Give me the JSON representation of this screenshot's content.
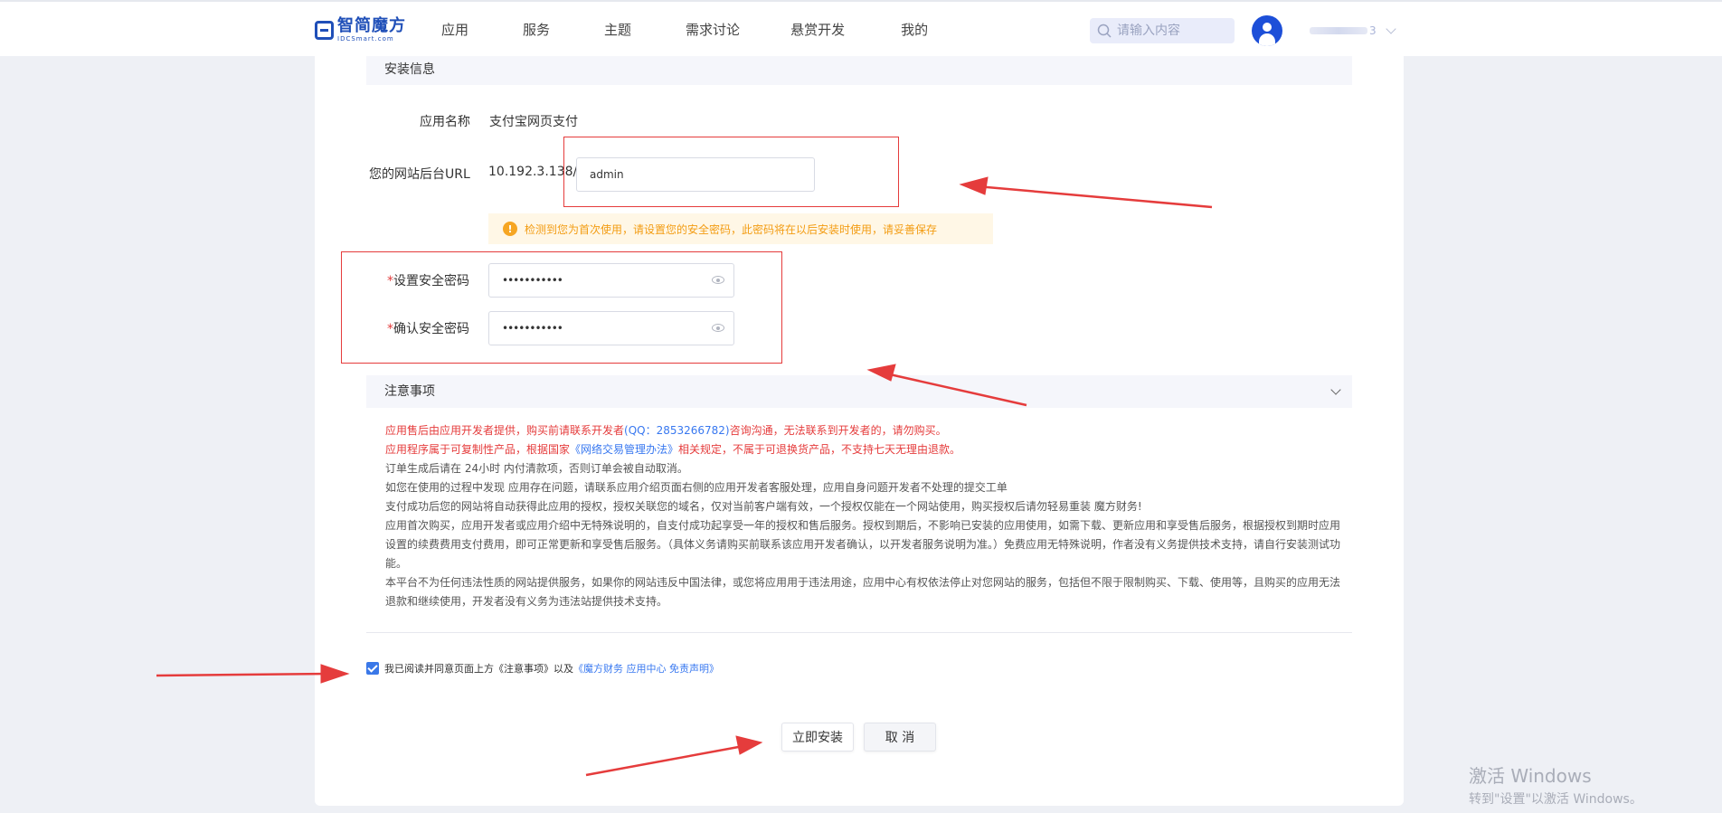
{
  "header": {
    "logo_cn": "智简魔方",
    "logo_en": "IDCSmart.com",
    "nav": [
      "应用",
      "服务",
      "主题",
      "需求讨论",
      "悬赏开发",
      "我的"
    ],
    "search_placeholder": "请输入内容",
    "username_suffix": "3"
  },
  "install": {
    "section_title": "安装信息",
    "app_name_label": "应用名称",
    "app_name_value": "支付宝网页支付",
    "url_label": "您的网站后台URL",
    "url_prefix": "10.192.3.138/",
    "url_input_value": "admin",
    "alert_icon": "!",
    "alert_text": "检测到您为首次使用，请设置您的安全密码，此密码将在以后安装时使用，请妥善保存",
    "required_mark": "*",
    "set_pwd_label": "设置安全密码",
    "set_pwd_value": "abcdefghijk",
    "confirm_pwd_label": "确认安全密码",
    "confirm_pwd_value": "abcdefghijk"
  },
  "notice": {
    "section_title": "注意事项",
    "line1_a": "应用售后由应用开发者提供，购买前请联系开发者",
    "line1_b": "(QQ：2853266782)",
    "line1_c": "咨询沟通，无法联系到开发者的，请勿购买。",
    "line2_a": "应用程序属于可复制性产品，根据国家",
    "line2_b": "《网络交易管理办法》",
    "line2_c": "相关规定，不属于可退换货产品，不支持七天无理由退款。",
    "line3": "订单生成后请在 24小时 内付清款项，否则订单会被自动取消。",
    "line4": "如您在使用的过程中发现 应用存在问题，请联系应用介绍页面右侧的应用开发者客服处理，应用自身问题开发者不处理的提交工单",
    "line5": "支付成功后您的网站将自动获得此应用的授权，授权关联您的域名，仅对当前客户端有效，一个授权仅能在一个网站使用，购买授权后请勿轻易重装 魔方财务!",
    "line6": "应用首次购买，应用开发者或应用介绍中无特殊说明的，自支付成功起享受一年的授权和售后服务。授权到期后，不影响已安装的应用使用，如需下载、更新应用和享受售后服务，根据授权到期时应用设置的续费费用支付费用，即可正常更新和享受售后服务。（具体义务请购买前联系该应用开发者确认，以开发者服务说明为准。）免费应用无特殊说明，作者没有义务提供技术支持，请自行安装测试功能。",
    "line7": "本平台不为任何违法性质的网站提供服务，如果你的网站违反中国法律，或您将应用用于违法用途，应用中心有权依法停止对您网站的服务，包括但不限于限制购买、下载、使用等，且购买的应用无法退款和继续使用，开发者没有义务为违法站提供技术支持。"
  },
  "agree": {
    "text": "我已阅读并同意页面上方《注意事项》以及",
    "link": "《魔方财务 应用中心 免责声明》"
  },
  "buttons": {
    "install": "立即安装",
    "cancel": "取 消"
  },
  "watermark": {
    "title": "激活 Windows",
    "subtitle": "转到\"设置\"以激活 Windows。"
  },
  "colors": {
    "brand": "#1f4fb8",
    "annotation": "#e53c3c",
    "link": "#3878f0",
    "warning": "#f39c12"
  }
}
